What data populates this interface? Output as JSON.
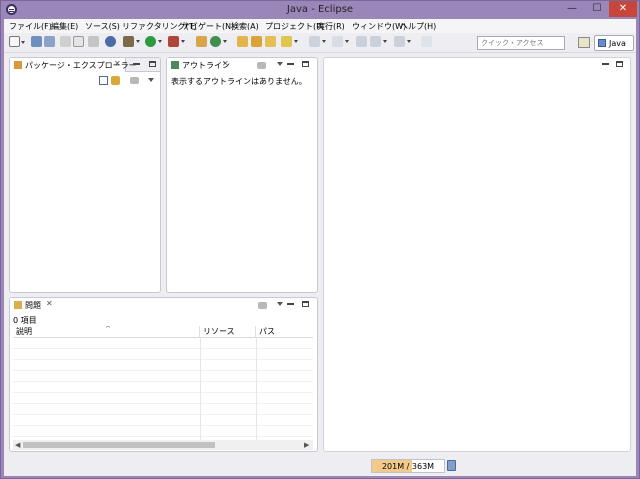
{
  "window": {
    "title": "Java - Eclipse"
  },
  "menu": [
    "ファイル(F)",
    "編集(E)",
    "ソース(S)",
    "リファクタリング(T)",
    "ナビゲート(N)",
    "検索(A)",
    "プロジェクト(P)",
    "実行(R)",
    "ウィンドウ(W)",
    "ヘルプ(H)"
  ],
  "toolbar": {
    "quick_access_placeholder": "クイック・アクセス",
    "perspective_label": "Java"
  },
  "package_explorer": {
    "tab_label": "パッケージ・エクスプローラー"
  },
  "outline": {
    "tab_label": "アウトライン",
    "message": "表示するアウトラインはありません。"
  },
  "problems": {
    "tab_label": "問題",
    "count_text": "0 項目",
    "columns": [
      "説明",
      "リソース",
      "パス"
    ]
  },
  "status": {
    "heap_text": "201M / 363M",
    "heap_used_fraction": 0.55
  },
  "colors": {
    "window_chrome": "#9b86b9",
    "close_button": "#c7463c",
    "heap_fill": "#f2c98a"
  }
}
